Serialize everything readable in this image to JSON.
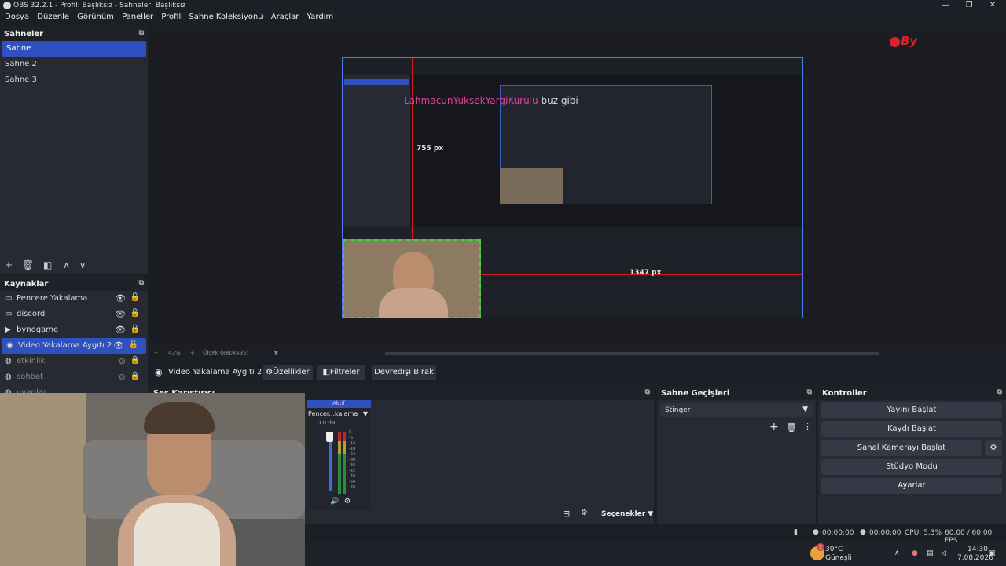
{
  "window": {
    "title": "OBS 32.2.1 - Profil: Başlıksız - Sahneler: Başlıksız",
    "minimize": "—",
    "maximize": "❐",
    "close": "✕"
  },
  "menu": [
    "Dosya",
    "Düzenle",
    "Görünüm",
    "Paneller",
    "Profil",
    "Sahne Koleksiyonu",
    "Araçlar",
    "Yardım"
  ],
  "scenes": {
    "header": "Sahneler",
    "items": [
      "Sahne",
      "Sahne 2",
      "Sahne 3"
    ],
    "selected": 0
  },
  "sources": {
    "header": "Kaynaklar",
    "items": [
      {
        "label": "Pencere Yakalama",
        "icon": "window-icon",
        "visible": true,
        "locked": false
      },
      {
        "label": "discord",
        "icon": "window-icon",
        "visible": true,
        "locked": false
      },
      {
        "label": "bynogame",
        "icon": "play-icon",
        "visible": true,
        "locked": true
      },
      {
        "label": "Video Yakalama Aygıtı 2",
        "icon": "camera-icon",
        "visible": true,
        "locked": false,
        "selected": true
      },
      {
        "label": "etkinlik",
        "icon": "globe-icon",
        "visible": false,
        "locked": true
      },
      {
        "label": "sohbet",
        "icon": "globe-icon",
        "visible": false,
        "locked": true
      },
      {
        "label": "uyarılar",
        "icon": "globe-icon",
        "visible": false,
        "locked": true
      }
    ]
  },
  "preview": {
    "overlay_text_pink": "LahmacunYuksekYargiKurulu",
    "overlay_text_white": "buz gibi",
    "measure_vertical": "755 px",
    "measure_horizontal": "1347 px",
    "badge": "By",
    "zoom": "43%",
    "scale_label": "Ölçek (880x495)"
  },
  "source_toolbar": {
    "name": "Video Yakalama Aygıtı 2",
    "properties": "Özellikler",
    "filters": "Filtreler",
    "deactivate": "Devredışı Bırak"
  },
  "mixer": {
    "header": "Ses Karıştırıcı",
    "active_label": "Aktif",
    "channel": "Pencer...kalama",
    "db": "0.0 dB",
    "scale": [
      "0",
      "-6",
      "-12",
      "-18",
      "-24",
      "-30",
      "-36",
      "-42",
      "-48",
      "-54",
      "-60"
    ],
    "options": "Seçenekler"
  },
  "transitions": {
    "header": "Sahne Geçişleri",
    "selected": "Stinger"
  },
  "controls": {
    "header": "Kontroller",
    "buttons": [
      "Yayını Başlat",
      "Kaydı Başlat",
      "Sanal Kamerayı Başlat",
      "Stüdyo Modu",
      "Ayarlar"
    ]
  },
  "status": {
    "stream_time": "00:00:00",
    "rec_time": "00:00:00",
    "cpu": "CPU: 5.3%",
    "fps": "60.00 / 60.00 FPS"
  },
  "taskbar": {
    "weather_temp": "30°C",
    "weather_desc": "Güneşli",
    "time": "14:30",
    "date": "7.08.2026",
    "notif": "1"
  },
  "colors": {
    "accent": "#2f51c0",
    "panel": "#272a33",
    "bg": "#1d1f26",
    "pink": "#e0429b",
    "red_guide": "#d11a1a"
  }
}
